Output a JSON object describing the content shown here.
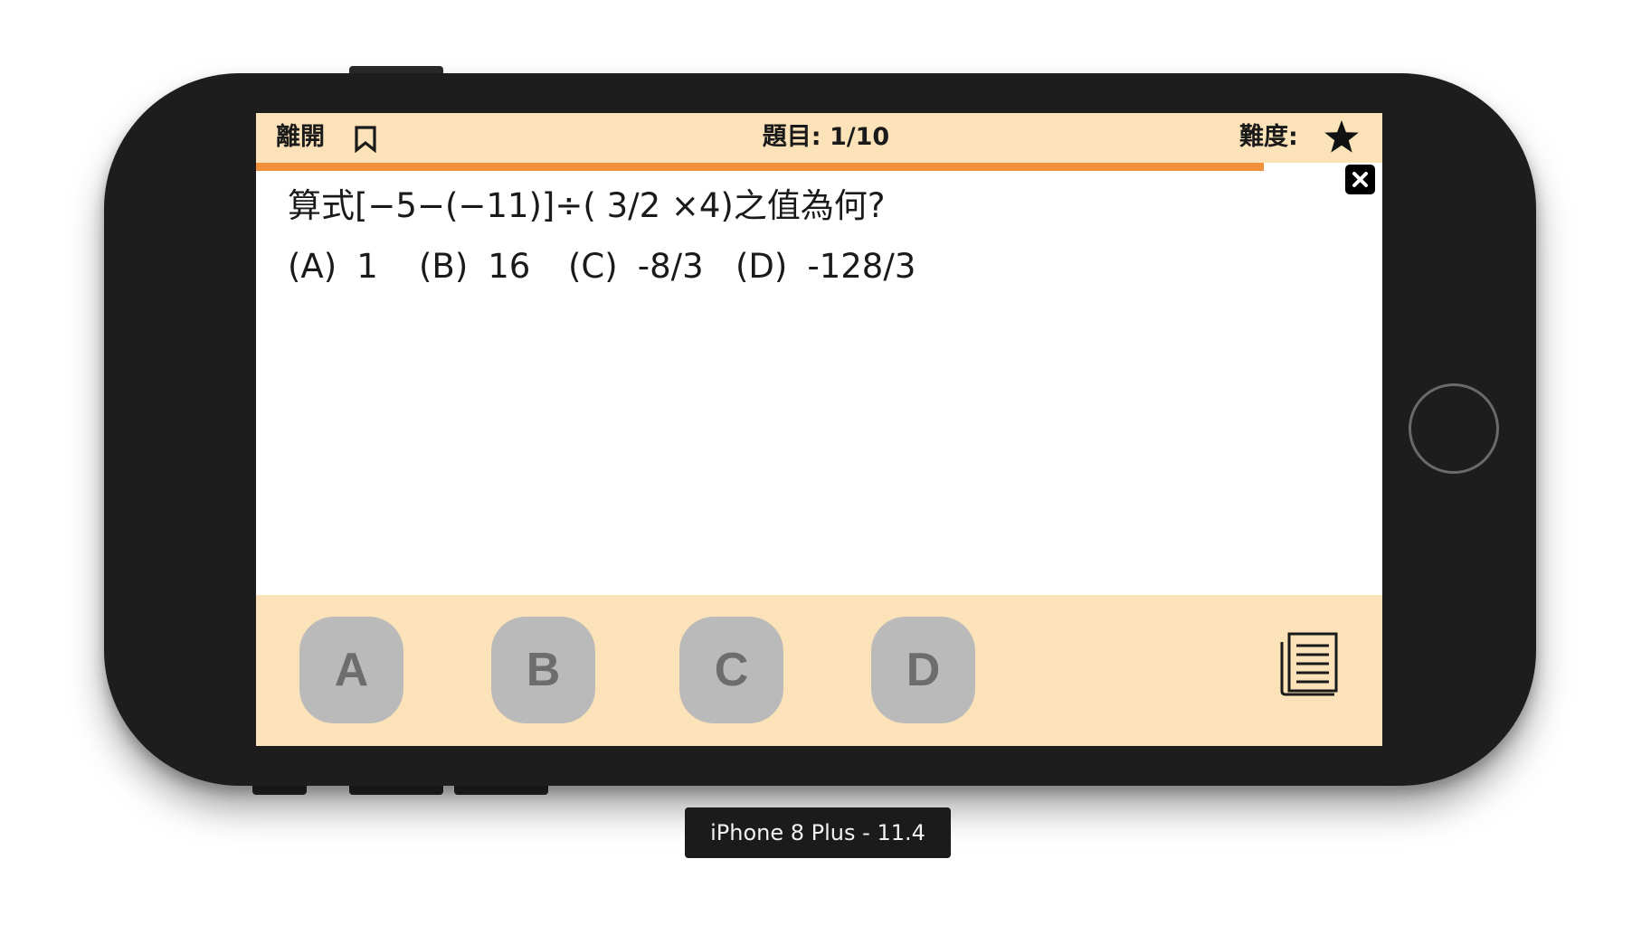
{
  "header": {
    "leave_label": "離開",
    "question_counter_prefix": "題目:",
    "question_counter": "1/10",
    "difficulty_label": "難度:",
    "difficulty_stars": 1
  },
  "progress": {
    "fraction": 0.895,
    "color": "#f18f3a"
  },
  "question": {
    "text": "算式[−5−(−11)]÷( 3/2 ×4)之值為何?",
    "options": [
      {
        "label": "(A)",
        "value": "1"
      },
      {
        "label": "(B)",
        "value": "16"
      },
      {
        "label": "(C)",
        "value": "-8/3"
      },
      {
        "label": "(D)",
        "value": "-128/3"
      }
    ]
  },
  "answers": {
    "buttons": [
      "A",
      "B",
      "C",
      "D"
    ]
  },
  "icons": {
    "bookmark": "bookmark-icon",
    "star": "star-icon",
    "close": "close-icon",
    "answer_sheet": "document-list-icon"
  },
  "colors": {
    "bar_background": "#fbe2b8",
    "progress": "#f18f3a",
    "answer_button": "#bababa",
    "answer_button_text": "#6d6d6d",
    "phone_body": "#1d1d1d"
  },
  "simulator": {
    "device_label": "iPhone 8 Plus - 11.4"
  }
}
